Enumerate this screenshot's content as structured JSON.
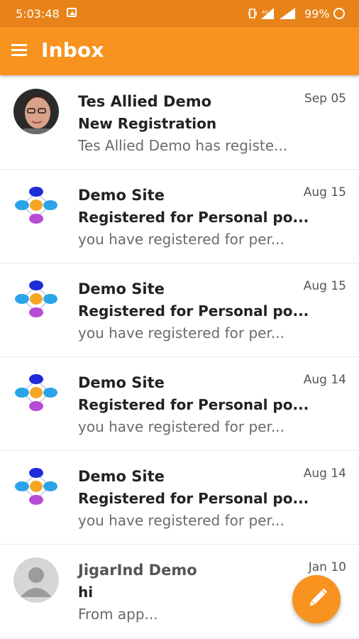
{
  "status_bar": {
    "time": "5:03:48",
    "battery": "99%"
  },
  "app_bar": {
    "title": "Inbox",
    "menu_icon": "hamburger-menu-icon"
  },
  "messages": [
    {
      "sender": "Tes Allied Demo",
      "subject": "New Registration",
      "preview": "Tes Allied Demo has registe...",
      "date": "Sep 05",
      "avatar": "photo-avatar"
    },
    {
      "sender": "Demo Site",
      "subject": "Registered for Personal po...",
      "preview": "you have registered for per...",
      "date": "Aug 15",
      "avatar": "demo-site-logo"
    },
    {
      "sender": "Demo Site",
      "subject": "Registered for Personal po...",
      "preview": "you have registered for per...",
      "date": "Aug 15",
      "avatar": "demo-site-logo"
    },
    {
      "sender": "Demo Site",
      "subject": "Registered for Personal po...",
      "preview": "you have registered for per...",
      "date": "Aug 14",
      "avatar": "demo-site-logo"
    },
    {
      "sender": "Demo Site",
      "subject": "Registered for Personal po...",
      "preview": "you have registered for per...",
      "date": "Aug 14",
      "avatar": "demo-site-logo"
    },
    {
      "sender": "JigarInd Demo",
      "subject": "hi",
      "preview": "From app...",
      "date": "Jan 10",
      "avatar": "default-user-avatar"
    }
  ],
  "fab": {
    "icon": "pencil-compose-icon"
  },
  "colors": {
    "status_bar": "#e8831a",
    "app_bar": "#f7931e",
    "fab": "#f7931e"
  }
}
